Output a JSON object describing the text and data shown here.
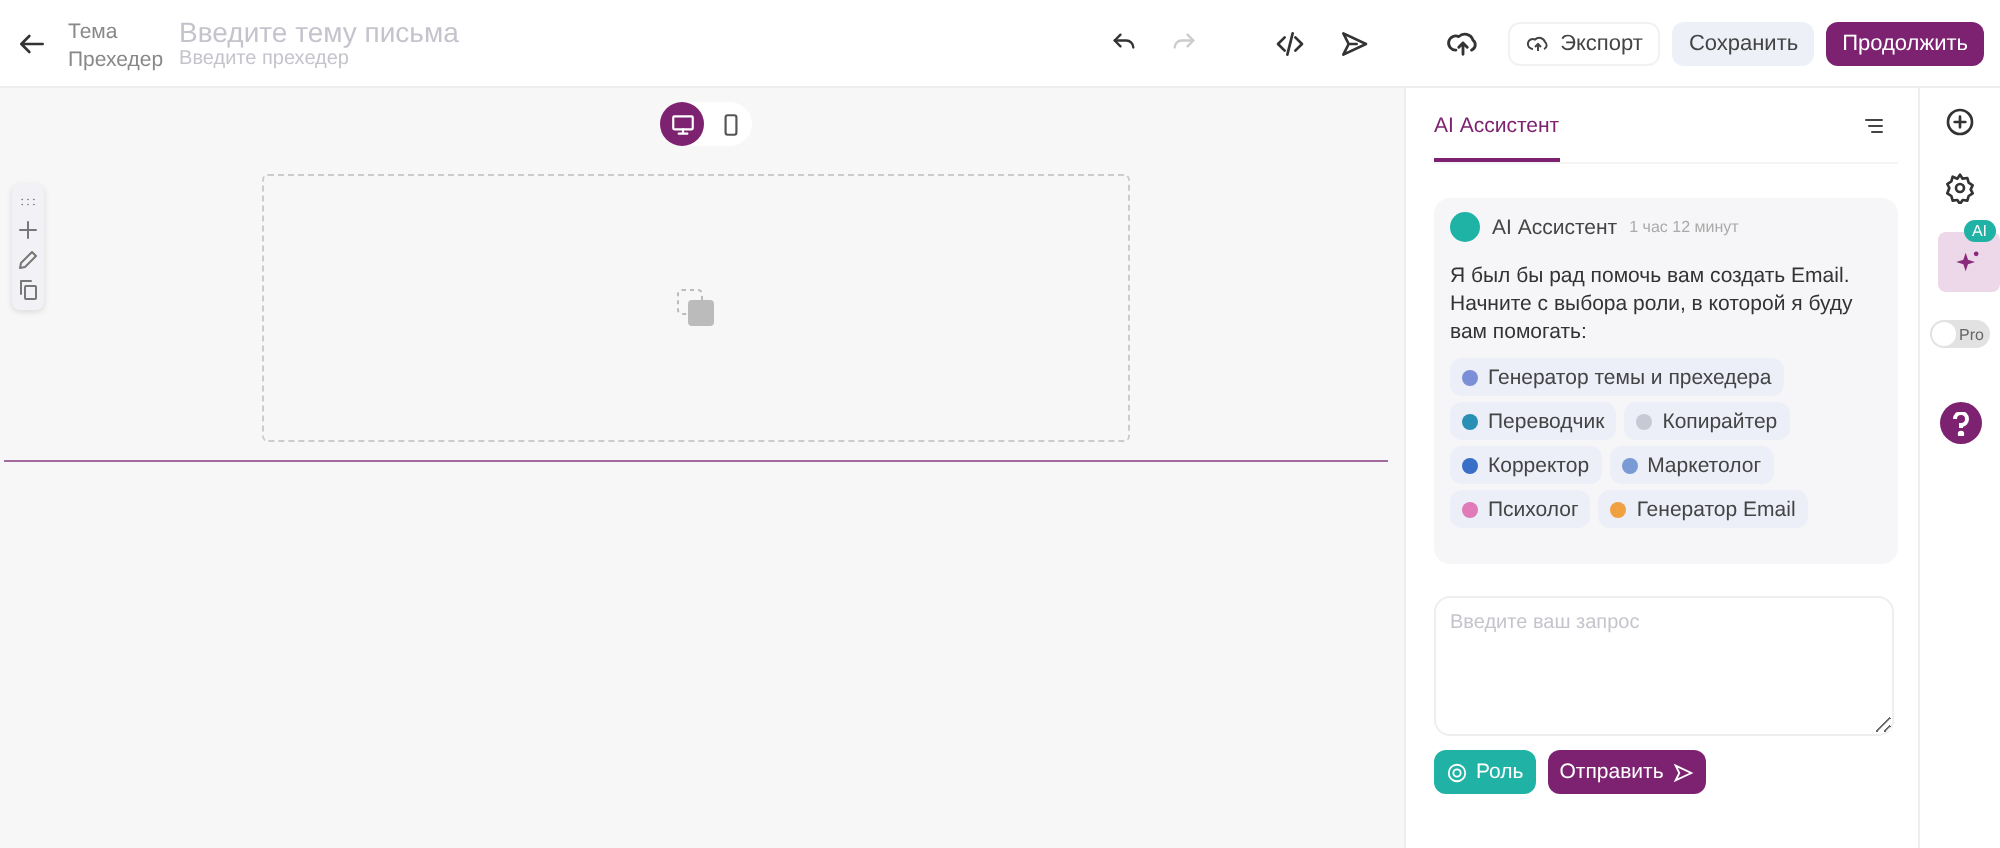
{
  "header": {
    "subject_label": "Тема",
    "subject_placeholder": "Введите тему письма",
    "preheader_label": "Прехедер",
    "preheader_placeholder": "Введите прехедер"
  },
  "toolbar": {
    "undo": {
      "disabled": false
    },
    "redo": {
      "disabled": true
    },
    "buttons": [
      {
        "kind": "export",
        "label": "Экспорт"
      },
      {
        "kind": "secondary",
        "label": "Сохранить"
      },
      {
        "kind": "primary",
        "label": "Продолжить"
      }
    ]
  },
  "devices": [
    {
      "kind": "desktop",
      "selected": true
    },
    {
      "kind": "mobile",
      "selected": false
    }
  ],
  "panel": {
    "tabs": [
      {
        "label": "AI Ассистент",
        "selected": true
      }
    ],
    "message": {
      "author": "AI Ассистент",
      "time": "1 час 12 минут",
      "text": "Я был бы рад помочь вам создать Email. Начните с выбора роли, в которой я буду вам помогать:"
    },
    "roles": [
      {
        "label": "Генератор темы и прехедера"
      },
      {
        "label": "Переводчик"
      },
      {
        "label": "Копирайтер"
      },
      {
        "label": "Корректор"
      },
      {
        "label": "Маркетолог"
      },
      {
        "label": "Психолог"
      },
      {
        "label": "Генератор Email"
      }
    ],
    "input": {
      "placeholder": "Введите ваш запрос"
    },
    "role_button": "Роль",
    "send_button": "Отправить"
  },
  "rail": {
    "ai_badge": "AI",
    "ai_selected": true,
    "pro": {
      "label": "Pro",
      "on": false
    }
  }
}
